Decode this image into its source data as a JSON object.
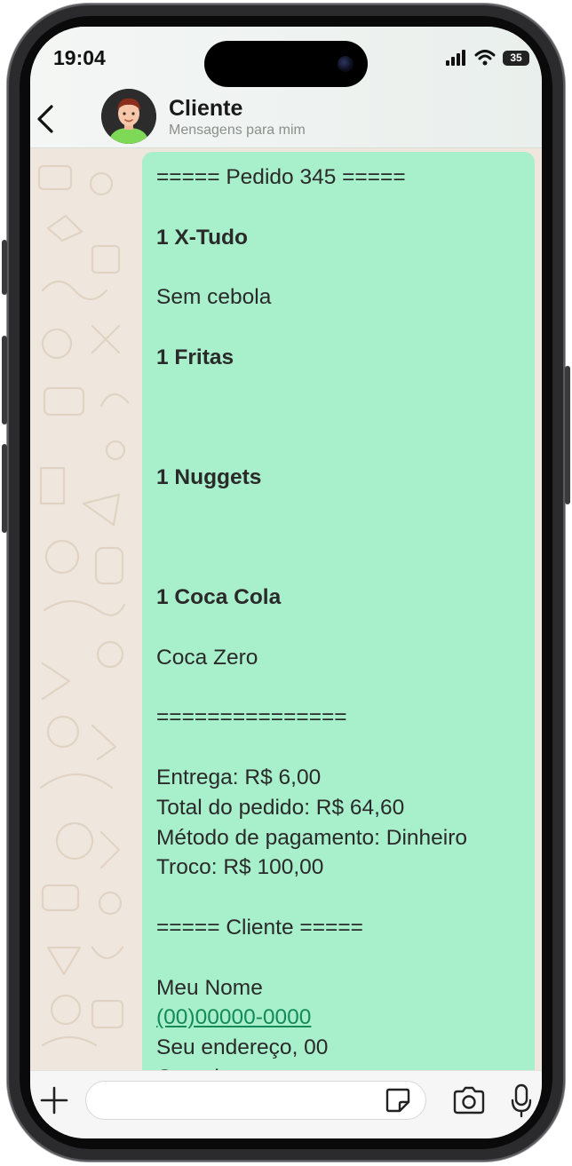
{
  "status_bar": {
    "time": "19:04",
    "battery": "35"
  },
  "header": {
    "contact_name": "Cliente",
    "subtitle": "Mensagens para mim"
  },
  "message": {
    "lines": [
      {
        "text": "===== Pedido 345 =====",
        "bold": false
      },
      {
        "text": "",
        "bold": false
      },
      {
        "text": "1 X-Tudo",
        "bold": true
      },
      {
        "text": "",
        "bold": false
      },
      {
        "text": "Sem cebola",
        "bold": false
      },
      {
        "text": "",
        "bold": false
      },
      {
        "text": "1 Fritas",
        "bold": true
      },
      {
        "text": "",
        "bold": false
      },
      {
        "text": "",
        "bold": false
      },
      {
        "text": "",
        "bold": false
      },
      {
        "text": "1 Nuggets",
        "bold": true
      },
      {
        "text": "",
        "bold": false
      },
      {
        "text": "",
        "bold": false
      },
      {
        "text": "",
        "bold": false
      },
      {
        "text": "1 Coca Cola",
        "bold": true
      },
      {
        "text": "",
        "bold": false
      },
      {
        "text": "Coca Zero",
        "bold": false
      },
      {
        "text": "",
        "bold": false
      },
      {
        "text": "===============",
        "bold": false
      },
      {
        "text": "",
        "bold": false
      },
      {
        "text": "Entrega: R$ 6,00",
        "bold": false
      },
      {
        "text": "Total do pedido: R$ 64,60",
        "bold": false
      },
      {
        "text": "Método de pagamento: Dinheiro",
        "bold": false
      },
      {
        "text": "Troco: R$ 100,00",
        "bold": false
      },
      {
        "text": "",
        "bold": false
      },
      {
        "text": "===== Cliente =====",
        "bold": false
      },
      {
        "text": "",
        "bold": false
      },
      {
        "text": "Meu Nome",
        "bold": false
      },
      {
        "text": "(00)00000-0000",
        "bold": false,
        "link": true
      },
      {
        "text": "Seu endereço, 00",
        "bold": false
      },
      {
        "text": "Complemento",
        "bold": false
      }
    ]
  },
  "input_bar": {
    "placeholder": ""
  },
  "colors": {
    "bubble": "#a8efcb",
    "chat_background": "#efe7dd",
    "link": "#148a5b"
  },
  "icons": {
    "back": "chevron-left-icon",
    "plus": "plus-icon",
    "sticker": "sticker-icon",
    "camera": "camera-icon",
    "mic": "microphone-icon"
  }
}
